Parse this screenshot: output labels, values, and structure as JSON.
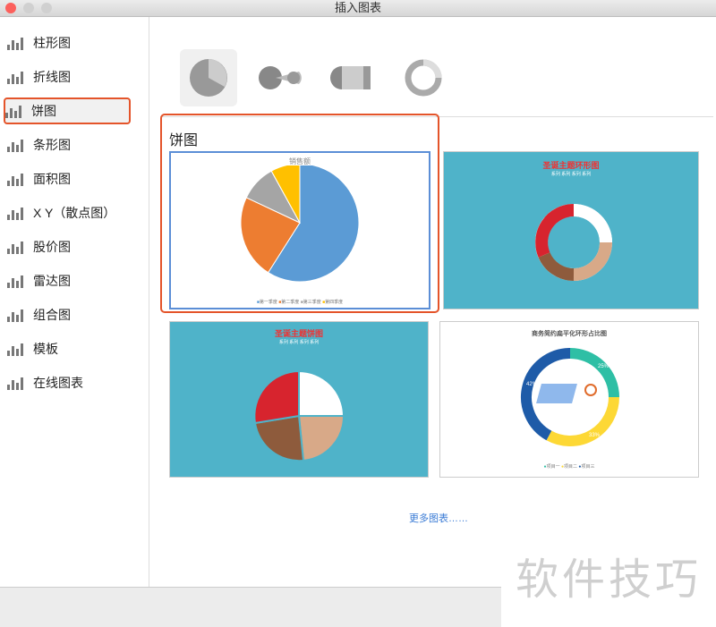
{
  "window": {
    "title": "插入图表"
  },
  "sidebar": {
    "items": [
      {
        "label": "柱形图"
      },
      {
        "label": "折线图"
      },
      {
        "label": "饼图"
      },
      {
        "label": "条形图"
      },
      {
        "label": "面积图"
      },
      {
        "label": "X Y（散点图）"
      },
      {
        "label": "股价图"
      },
      {
        "label": "雷达图"
      },
      {
        "label": "组合图"
      },
      {
        "label": "模板"
      },
      {
        "label": "在线图表"
      }
    ],
    "selected": "饼图"
  },
  "main": {
    "types": [
      "pie",
      "pie-exploded",
      "bar-of-pie",
      "doughnut"
    ],
    "section_title": "饼图",
    "more_link": "更多图表……",
    "templates": [
      {
        "title": "销售额",
        "legend": [
          "第一季度",
          "第二季度",
          "第三季度",
          "第四季度"
        ]
      },
      {
        "title": "圣诞主题环形图",
        "legend": [
          "系列",
          "系列",
          "系列",
          "系列"
        ]
      },
      {
        "title": "圣诞主题饼图",
        "legend": [
          "系列",
          "系列",
          "系列",
          "系列"
        ]
      },
      {
        "title": "商务简约扁平化环形占比图",
        "legend": [
          "项目一",
          "项目二",
          "项目三"
        ],
        "labels": [
          "25%",
          "33%",
          "42%"
        ]
      }
    ]
  },
  "chart_data": [
    {
      "type": "pie",
      "title": "销售额",
      "categories": [
        "第一季度",
        "第二季度",
        "第三季度",
        "第四季度"
      ],
      "values": [
        59,
        23,
        10,
        8
      ],
      "colors": [
        "#5b9bd5",
        "#ed7d31",
        "#a5a5a5",
        "#ffc000"
      ]
    },
    {
      "type": "pie",
      "title": "商务简约扁平化环形占比图",
      "categories": [
        "项目一",
        "项目二",
        "项目三"
      ],
      "values": [
        25,
        33,
        42
      ],
      "colors": [
        "#2ebfa5",
        "#fdd835",
        "#1e5ba8"
      ]
    }
  ],
  "watermark": "软件技巧"
}
